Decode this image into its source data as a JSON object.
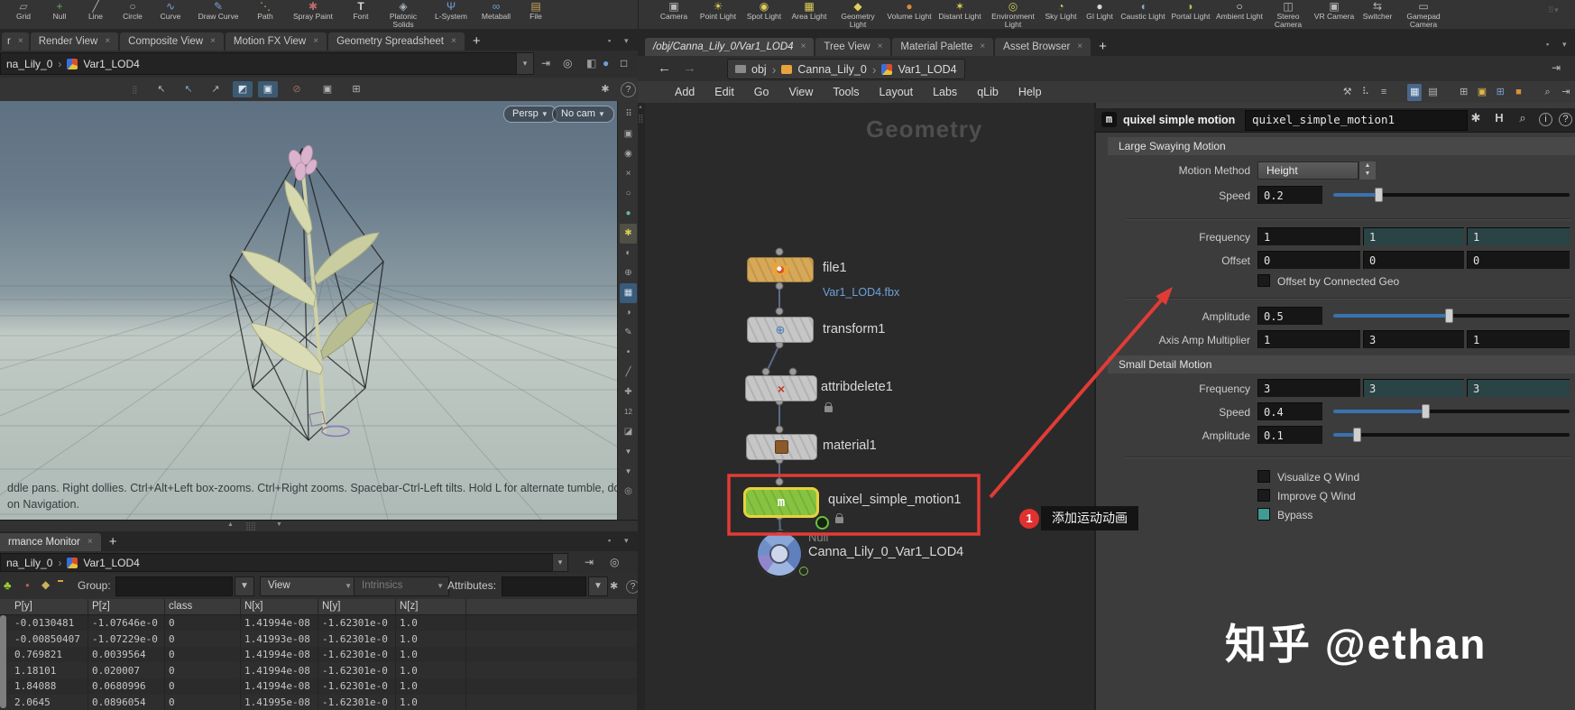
{
  "shelf": {
    "left_tools": [
      "Grid",
      "Null",
      "Line",
      "Circle",
      "Curve",
      "Draw Curve",
      "Path",
      "Spray Paint",
      "Font",
      "Platonic Solids",
      "L-System",
      "Metaball",
      "File"
    ],
    "right_tools": [
      "Camera",
      "Point Light",
      "Spot Light",
      "Area Light",
      "Geometry Light",
      "Volume Light",
      "Distant Light",
      "Environment Light",
      "Sky Light",
      "GI Light",
      "Caustic Light",
      "Portal Light",
      "Ambient Light",
      "Stereo Camera",
      "VR Camera",
      "Switcher",
      "Gamepad Camera"
    ]
  },
  "viewport": {
    "tabs": [
      "r",
      "Render View",
      "Composite View",
      "Motion FX View",
      "Geometry Spreadsheet"
    ],
    "path_prefix": "na_Lily_0",
    "path_node": "Var1_LOD4",
    "persp": "Persp",
    "cam": "No cam",
    "help_line1": "ddle pans. Right dollies. Ctrl+Alt+Left box-zooms. Ctrl+Right zooms. Spacebar-Ctrl-Left tilts. Hold L for alternate tumble, dolly, and zoom.",
    "help_line2": "on Navigation."
  },
  "monitor": {
    "tab": "rmance Monitor",
    "path_prefix": "na_Lily_0",
    "path_node": "Var1_LOD4",
    "group_label": "Group:",
    "view": "View",
    "intrinsics": "Intrinsics",
    "attributes_label": "Attributes:",
    "headers": [
      "P[y]",
      "P[z]",
      "class",
      "N[x]",
      "N[y]",
      "N[z]"
    ],
    "rows": [
      [
        "-0.0130481",
        "-1.07646e-0",
        "0",
        "1.41994e-08",
        "-1.62301e-0",
        "1.0"
      ],
      [
        "-0.00850407",
        "-1.07229e-0",
        "0",
        "1.41993e-08",
        "-1.62301e-0",
        "1.0"
      ],
      [
        "0.769821",
        "0.0039564",
        "0",
        "1.41994e-08",
        "-1.62301e-0",
        "1.0"
      ],
      [
        "1.18101",
        "0.020007",
        "0",
        "1.41994e-08",
        "-1.62301e-0",
        "1.0"
      ],
      [
        "1.84088",
        "0.0680996",
        "0",
        "1.41994e-08",
        "-1.62301e-0",
        "1.0"
      ],
      [
        "2.0645",
        "0.0896054",
        "0",
        "1.41995e-08",
        "-1.62301e-0",
        "1.0"
      ]
    ]
  },
  "network": {
    "tabs": [
      "/obj/Canna_Lily_0/Var1_LOD4",
      "Tree View",
      "Material Palette",
      "Asset Browser"
    ],
    "crumbs": [
      "obj",
      "Canna_Lily_0",
      "Var1_LOD4"
    ],
    "menu": [
      "Add",
      "Edit",
      "Go",
      "View",
      "Tools",
      "Layout",
      "Labs",
      "qLib",
      "Help"
    ],
    "watermark": "Geometry",
    "nodes": {
      "file": {
        "label": "file1",
        "sub": "Var1_LOD4.fbx"
      },
      "transform": {
        "label": "transform1"
      },
      "attribdelete": {
        "label": "attribdelete1"
      },
      "material": {
        "label": "material1"
      },
      "quixel": {
        "label": "quixel_simple_motion1",
        "badge": "m"
      },
      "nullnode": {
        "type": "Null",
        "label": "Canna_Lily_0_Var1_LOD4"
      }
    }
  },
  "params": {
    "type_label": "quixel simple motion",
    "name": "quixel_simple_motion1",
    "badge": "m",
    "large": {
      "title": "Large Swaying Motion",
      "motion_method_label": "Motion Method",
      "motion_method": "Height",
      "speed_label": "Speed",
      "speed": "0.2",
      "frequency_label": "Frequency",
      "frequency": [
        "1",
        "1",
        "1"
      ],
      "offset_label": "Offset",
      "offset": [
        "0",
        "0",
        "0"
      ],
      "offset_geo": "Offset by Connected Geo",
      "amplitude_label": "Amplitude",
      "amplitude": "0.5",
      "axis_label": "Axis Amp Multiplier",
      "axis": [
        "1",
        "3",
        "1"
      ]
    },
    "small": {
      "title": "Small Detail Motion",
      "frequency_label": "Frequency",
      "frequency": [
        "3",
        "3",
        "3"
      ],
      "speed_label": "Speed",
      "speed": "0.4",
      "amplitude_label": "Amplitude",
      "amplitude": "0.1"
    },
    "toggles": [
      "Visualize Q Wind",
      "Improve Q Wind",
      "Bypass"
    ]
  },
  "annotation": {
    "badge": "1",
    "text": "添加运动动画"
  },
  "site_watermark": "知乎 @ethan",
  "colors": {
    "accent_red": "#e23b36",
    "node_green": "#86c440",
    "node_yellow_border": "#e6d23e",
    "wire_blue": "#5a6b8c",
    "teal_field": "#2a4344",
    "slider_blue": "#3a72b0",
    "link_blue": "#6da0dd",
    "bypass_teal": "#419a94"
  }
}
